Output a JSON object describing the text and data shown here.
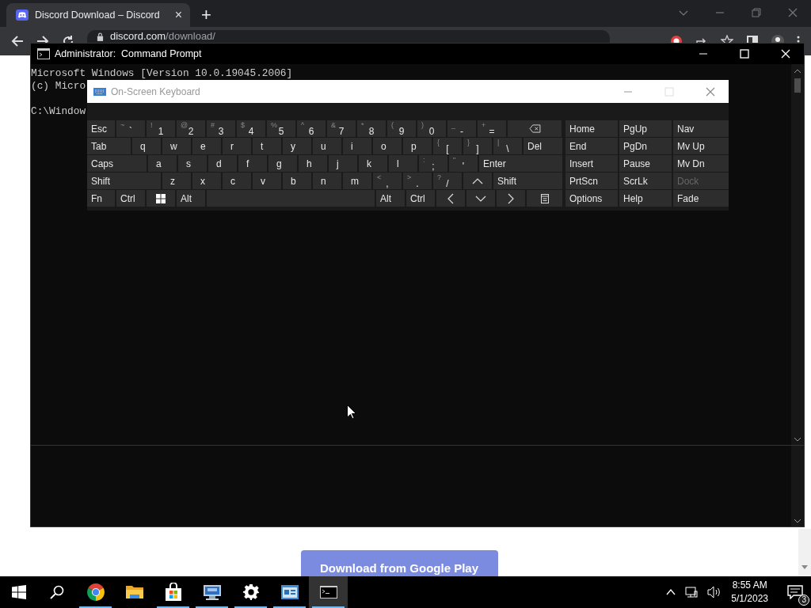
{
  "browser": {
    "tab": {
      "title": "Discord Download – Discord",
      "close": "×"
    },
    "new_tab": "+",
    "address": {
      "host": "discord.com",
      "path": "/download/"
    },
    "page_button": "Download from Google Play"
  },
  "cmd": {
    "title": "Administrator:  Command Prompt",
    "lines": [
      "Microsoft Windows [Version 10.0.19045.2006]",
      "(c) Micro"
    ],
    "prompt": "C:\\Window"
  },
  "osk": {
    "title": "On-Screen Keyboard",
    "rows": [
      {
        "keys": [
          {
            "kind": "mod",
            "label": "Esc"
          },
          {
            "kind": "dual",
            "shift": "~",
            "label": "`"
          },
          {
            "kind": "dual",
            "shift": "!",
            "label": "1"
          },
          {
            "kind": "dual",
            "shift": "@",
            "label": "2"
          },
          {
            "kind": "dual",
            "shift": "#",
            "label": "3"
          },
          {
            "kind": "dual",
            "shift": "$",
            "label": "4"
          },
          {
            "kind": "dual",
            "shift": "%",
            "label": "5"
          },
          {
            "kind": "dual",
            "shift": "^",
            "label": "6"
          },
          {
            "kind": "dual",
            "shift": "&",
            "label": "7"
          },
          {
            "kind": "dual",
            "shift": "*",
            "label": "8"
          },
          {
            "kind": "dual",
            "shift": "(",
            "label": "9"
          },
          {
            "kind": "dual",
            "shift": ")",
            "label": "0"
          },
          {
            "kind": "dual",
            "shift": "_",
            "label": "-"
          },
          {
            "kind": "dual",
            "shift": "+",
            "label": "="
          },
          {
            "kind": "backspace"
          }
        ]
      },
      {
        "keys": [
          {
            "kind": "mod",
            "label": "Tab"
          },
          {
            "kind": "char",
            "label": "q"
          },
          {
            "kind": "char",
            "label": "w"
          },
          {
            "kind": "char",
            "label": "e"
          },
          {
            "kind": "char",
            "label": "r"
          },
          {
            "kind": "char",
            "label": "t"
          },
          {
            "kind": "char",
            "label": "y"
          },
          {
            "kind": "char",
            "label": "u"
          },
          {
            "kind": "char",
            "label": "i"
          },
          {
            "kind": "char",
            "label": "o"
          },
          {
            "kind": "char",
            "label": "p"
          },
          {
            "kind": "dual",
            "shift": "{",
            "label": "["
          },
          {
            "kind": "dual",
            "shift": "}",
            "label": "]"
          },
          {
            "kind": "dual",
            "shift": "|",
            "label": "\\"
          },
          {
            "kind": "mod",
            "label": "Del"
          }
        ]
      },
      {
        "keys": [
          {
            "kind": "mod",
            "label": "Caps"
          },
          {
            "kind": "char",
            "label": "a"
          },
          {
            "kind": "char",
            "label": "s"
          },
          {
            "kind": "char",
            "label": "d"
          },
          {
            "kind": "char",
            "label": "f"
          },
          {
            "kind": "char",
            "label": "g"
          },
          {
            "kind": "char",
            "label": "h"
          },
          {
            "kind": "char",
            "label": "j"
          },
          {
            "kind": "char",
            "label": "k"
          },
          {
            "kind": "char",
            "label": "l"
          },
          {
            "kind": "dual",
            "shift": ":",
            "label": ";"
          },
          {
            "kind": "dual",
            "shift": "\"",
            "label": "'"
          },
          {
            "kind": "mod",
            "label": "Enter"
          }
        ]
      },
      {
        "keys": [
          {
            "kind": "mod",
            "label": "Shift"
          },
          {
            "kind": "char",
            "label": "z"
          },
          {
            "kind": "char",
            "label": "x"
          },
          {
            "kind": "char",
            "label": "c"
          },
          {
            "kind": "char",
            "label": "v"
          },
          {
            "kind": "char",
            "label": "b"
          },
          {
            "kind": "char",
            "label": "n"
          },
          {
            "kind": "char",
            "label": "m"
          },
          {
            "kind": "dual",
            "shift": "<",
            "label": ","
          },
          {
            "kind": "dual",
            "shift": ">",
            "label": "."
          },
          {
            "kind": "dual",
            "shift": "?",
            "label": "/"
          },
          {
            "kind": "up"
          },
          {
            "kind": "mod",
            "label": "Shift"
          }
        ]
      },
      {
        "keys": [
          {
            "kind": "mod",
            "label": "Fn"
          },
          {
            "kind": "mod",
            "label": "Ctrl"
          },
          {
            "kind": "winkey"
          },
          {
            "kind": "mod",
            "label": "Alt"
          },
          {
            "kind": "space"
          },
          {
            "kind": "mod",
            "label": "Alt"
          },
          {
            "kind": "mod",
            "label": "Ctrl"
          },
          {
            "kind": "left"
          },
          {
            "kind": "down"
          },
          {
            "kind": "right"
          },
          {
            "kind": "menu"
          }
        ]
      }
    ],
    "panel": [
      [
        {
          "label": "Home",
          "disabled": false
        },
        {
          "label": "PgUp",
          "disabled": false
        },
        {
          "label": "Nav",
          "disabled": false
        }
      ],
      [
        {
          "label": "End",
          "disabled": false
        },
        {
          "label": "PgDn",
          "disabled": false
        },
        {
          "label": "Mv Up",
          "disabled": false
        }
      ],
      [
        {
          "label": "Insert",
          "disabled": false
        },
        {
          "label": "Pause",
          "disabled": false
        },
        {
          "label": "Mv Dn",
          "disabled": false
        }
      ],
      [
        {
          "label": "PrtScn",
          "disabled": false
        },
        {
          "label": "ScrLk",
          "disabled": false
        },
        {
          "label": "Dock",
          "disabled": true
        }
      ],
      [
        {
          "label": "Options",
          "disabled": false
        },
        {
          "label": "Help",
          "disabled": false
        },
        {
          "label": "Fade",
          "disabled": false
        }
      ]
    ]
  },
  "taskbar": {
    "apps": [
      {
        "kind": "browser",
        "running": true,
        "active": false
      },
      {
        "kind": "folder",
        "running": false,
        "active": false
      },
      {
        "kind": "store",
        "running": true,
        "active": false
      },
      {
        "kind": "remote",
        "running": true,
        "active": false
      },
      {
        "kind": "settings",
        "running": true,
        "active": false
      },
      {
        "kind": "panel",
        "running": true,
        "active": false
      },
      {
        "kind": "terminal",
        "running": true,
        "active": true
      }
    ],
    "clock": {
      "time": "8:55 AM",
      "date": "5/1/2023"
    },
    "notifications": "3"
  }
}
